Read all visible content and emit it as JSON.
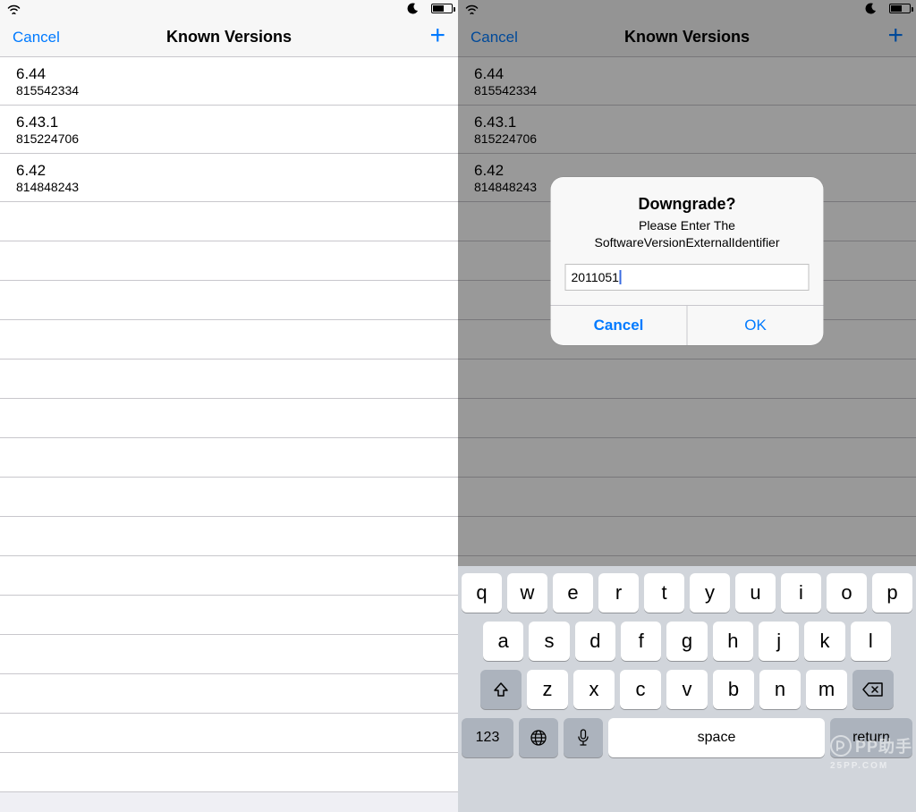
{
  "status": {
    "battery_pct": 55
  },
  "nav": {
    "cancel": "Cancel",
    "title": "Known Versions",
    "add_glyph": "+"
  },
  "versions": [
    {
      "version": "6.44",
      "id": "815542334"
    },
    {
      "version": "6.43.1",
      "id": "815224706"
    },
    {
      "version": "6.42",
      "id": "814848243"
    }
  ],
  "alert": {
    "title": "Downgrade?",
    "message_line1": "Please Enter The",
    "message_line2": "SoftwareVersionExternalIdentifier",
    "input_value": "2011051",
    "cancel": "Cancel",
    "ok": "OK"
  },
  "keyboard": {
    "row1": [
      "q",
      "w",
      "e",
      "r",
      "t",
      "y",
      "u",
      "i",
      "o",
      "p"
    ],
    "row2": [
      "a",
      "s",
      "d",
      "f",
      "g",
      "h",
      "j",
      "k",
      "l"
    ],
    "row3": [
      "z",
      "x",
      "c",
      "v",
      "b",
      "n",
      "m"
    ],
    "numkey": "123",
    "space": "space",
    "return": "return"
  },
  "watermark": {
    "brand": "PP助手",
    "site": "25PP.COM"
  }
}
